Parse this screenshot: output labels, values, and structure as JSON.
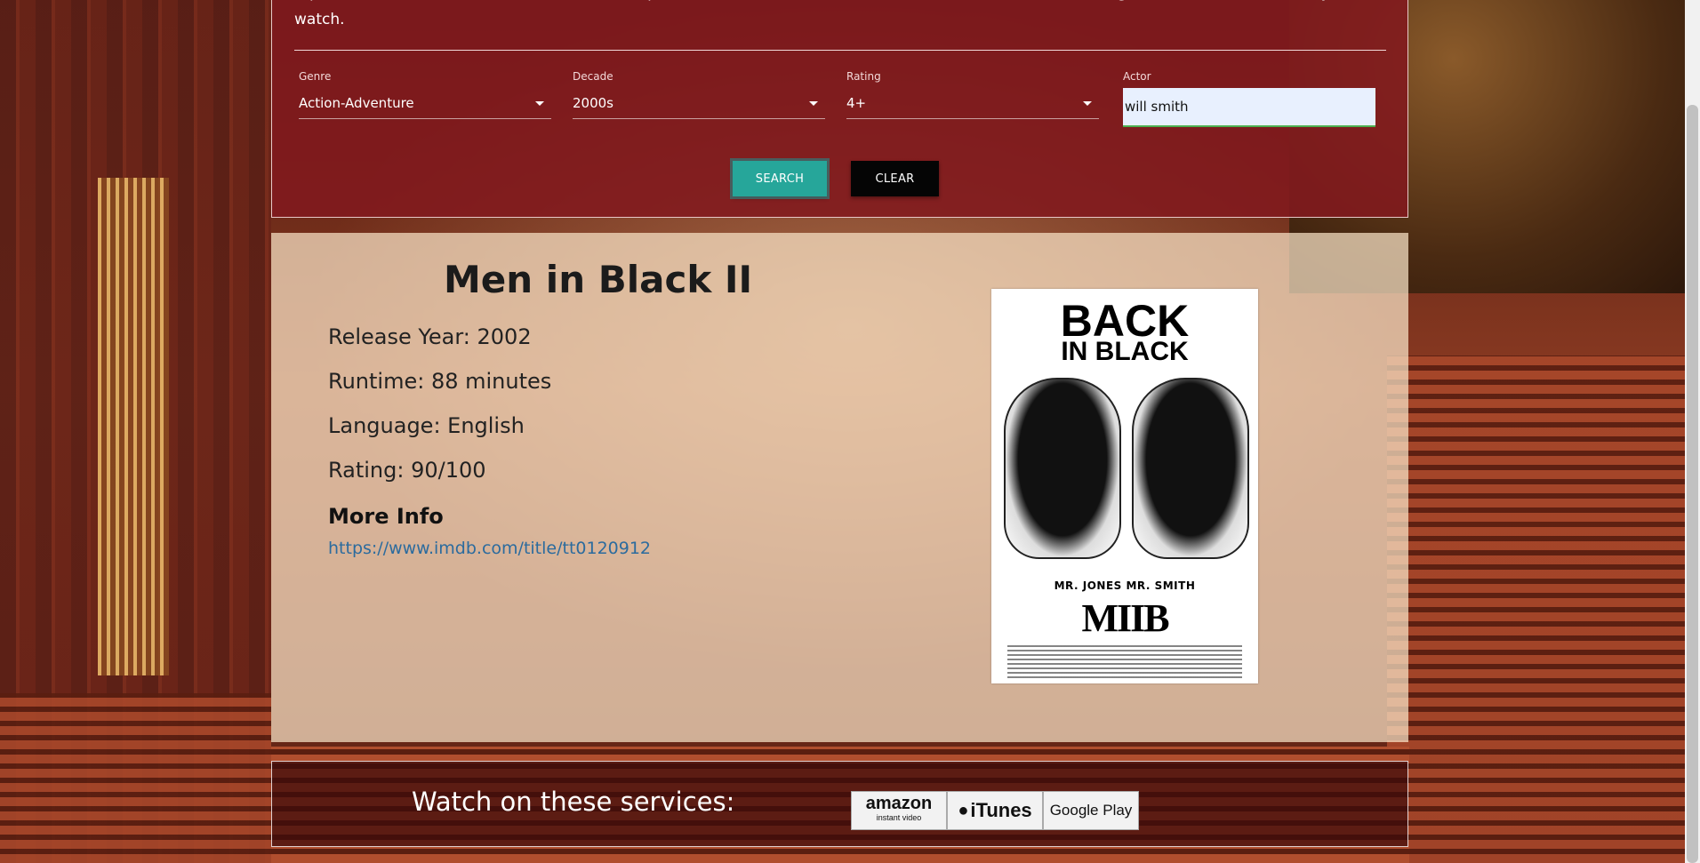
{
  "search": {
    "intro_text": "…phenomenon of \"Netflix and Scroll.\" That stops now! Select some basic criteria and let our random search generator find a movie for you to watch.",
    "genre": {
      "label": "Genre",
      "value": "Action-Adventure"
    },
    "decade": {
      "label": "Decade",
      "value": "2000s"
    },
    "rating": {
      "label": "Rating",
      "value": "4+"
    },
    "actor": {
      "label": "Actor",
      "value": "will smith"
    },
    "search_button": "SEARCH",
    "clear_button": "CLEAR"
  },
  "movie": {
    "title": "Men in Black II",
    "release_year": "Release Year: 2002",
    "runtime": "Runtime: 88 minutes",
    "language": "Language: English",
    "rating": "Rating: 90/100",
    "more_info_heading": "More Info",
    "imdb_url": "https://www.imdb.com/title/tt0120912",
    "poster": {
      "headline_1": "BACK",
      "headline_2": "IN BLACK",
      "names": "MR. JONES    MR. SMITH",
      "logo": "MIIB"
    }
  },
  "services": {
    "label": "Watch on these services:",
    "amazon": "amazon",
    "amazon_sub": "instant video",
    "itunes": "iTunes",
    "google_play": "Google Play"
  },
  "colors": {
    "search_panel": "#82191e",
    "search_button": "#26a69a",
    "clear_button": "#050505",
    "link": "#2b6b9e"
  }
}
